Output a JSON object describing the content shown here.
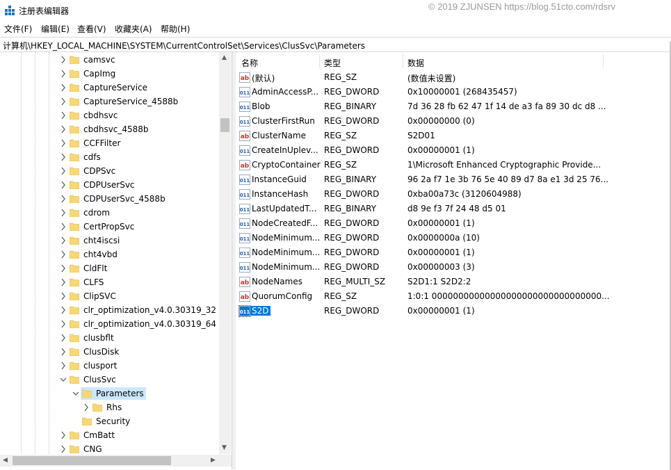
{
  "window": {
    "title": "注册表编辑器",
    "watermark": "© 2019 ZJUNSEN https://blog.51cto.com/rdsrv"
  },
  "menu": [
    "文件(F)",
    "编辑(E)",
    "查看(V)",
    "收藏夹(A)",
    "帮助(H)"
  ],
  "address": "计算机\\HKEY_LOCAL_MACHINE\\SYSTEM\\CurrentControlSet\\Services\\ClusSvc\\Parameters",
  "tree": {
    "items": [
      {
        "label": "camsvc",
        "level": 1,
        "expander": "collapsed"
      },
      {
        "label": "CapImg",
        "level": 1,
        "expander": "collapsed"
      },
      {
        "label": "CaptureService",
        "level": 1,
        "expander": "collapsed"
      },
      {
        "label": "CaptureService_4588b",
        "level": 1,
        "expander": "collapsed"
      },
      {
        "label": "cbdhsvc",
        "level": 1,
        "expander": "collapsed"
      },
      {
        "label": "cbdhsvc_4588b",
        "level": 1,
        "expander": "collapsed"
      },
      {
        "label": "CCFFilter",
        "level": 1,
        "expander": "collapsed"
      },
      {
        "label": "cdfs",
        "level": 1,
        "expander": "collapsed"
      },
      {
        "label": "CDPSvc",
        "level": 1,
        "expander": "collapsed"
      },
      {
        "label": "CDPUserSvc",
        "level": 1,
        "expander": "collapsed"
      },
      {
        "label": "CDPUserSvc_4588b",
        "level": 1,
        "expander": "collapsed"
      },
      {
        "label": "cdrom",
        "level": 1,
        "expander": "collapsed"
      },
      {
        "label": "CertPropSvc",
        "level": 1,
        "expander": "collapsed"
      },
      {
        "label": "cht4iscsi",
        "level": 1,
        "expander": "collapsed"
      },
      {
        "label": "cht4vbd",
        "level": 1,
        "expander": "collapsed"
      },
      {
        "label": "CldFlt",
        "level": 1,
        "expander": "collapsed"
      },
      {
        "label": "CLFS",
        "level": 1,
        "expander": "collapsed"
      },
      {
        "label": "ClipSVC",
        "level": 1,
        "expander": "collapsed"
      },
      {
        "label": "clr_optimization_v4.0.30319_32",
        "level": 1,
        "expander": "collapsed"
      },
      {
        "label": "clr_optimization_v4.0.30319_64",
        "level": 1,
        "expander": "collapsed"
      },
      {
        "label": "clusbflt",
        "level": 1,
        "expander": "collapsed"
      },
      {
        "label": "ClusDisk",
        "level": 1,
        "expander": "collapsed"
      },
      {
        "label": "clusport",
        "level": 1,
        "expander": "collapsed"
      },
      {
        "label": "ClusSvc",
        "level": 1,
        "expander": "expanded"
      },
      {
        "label": "Parameters",
        "level": 2,
        "expander": "expanded",
        "selected": true
      },
      {
        "label": "Rhs",
        "level": 3,
        "expander": "collapsed"
      },
      {
        "label": "Security",
        "level": 2,
        "expander": "none"
      },
      {
        "label": "CmBatt",
        "level": 1,
        "expander": "collapsed"
      },
      {
        "label": "CNG",
        "level": 1,
        "expander": "collapsed"
      }
    ]
  },
  "list": {
    "headers": {
      "name": "名称",
      "type": "类型",
      "data": "数据"
    },
    "rows": [
      {
        "icon": "string-value-icon",
        "name": "(默认)",
        "type": "REG_SZ",
        "data": "(数值未设置)"
      },
      {
        "icon": "binary-value-icon",
        "name": "AdminAccessP...",
        "type": "REG_DWORD",
        "data": "0x10000001 (268435457)"
      },
      {
        "icon": "binary-value-icon",
        "name": "Blob",
        "type": "REG_BINARY",
        "data": "7d 36 28 fb 62 47 1f 14 de a3 fa 89 30 dc d8 ..."
      },
      {
        "icon": "binary-value-icon",
        "name": "ClusterFirstRun",
        "type": "REG_DWORD",
        "data": "0x00000000 (0)"
      },
      {
        "icon": "string-value-icon",
        "name": "ClusterName",
        "type": "REG_SZ",
        "data": "S2D01"
      },
      {
        "icon": "binary-value-icon",
        "name": "CreateInUplev...",
        "type": "REG_DWORD",
        "data": "0x00000001 (1)"
      },
      {
        "icon": "string-value-icon",
        "name": "CryptoContainer",
        "type": "REG_SZ",
        "data": "1\\Microsoft Enhanced Cryptographic Provide..."
      },
      {
        "icon": "binary-value-icon",
        "name": "InstanceGuid",
        "type": "REG_BINARY",
        "data": "96 2a f7 1e 3b 76 5e 40 89 d7 8a e1 3d 25 76..."
      },
      {
        "icon": "binary-value-icon",
        "name": "InstanceHash",
        "type": "REG_DWORD",
        "data": "0xba00a73c (3120604988)"
      },
      {
        "icon": "binary-value-icon",
        "name": "LastUpdatedT...",
        "type": "REG_BINARY",
        "data": "d8 9e f3 7f 24 48 d5 01"
      },
      {
        "icon": "binary-value-icon",
        "name": "NodeCreatedF...",
        "type": "REG_DWORD",
        "data": "0x00000001 (1)"
      },
      {
        "icon": "binary-value-icon",
        "name": "NodeMinimum...",
        "type": "REG_DWORD",
        "data": "0x0000000a (10)"
      },
      {
        "icon": "binary-value-icon",
        "name": "NodeMinimum...",
        "type": "REG_DWORD",
        "data": "0x00000001 (1)"
      },
      {
        "icon": "binary-value-icon",
        "name": "NodeMinimum...",
        "type": "REG_DWORD",
        "data": "0x00000003 (3)"
      },
      {
        "icon": "string-value-icon",
        "name": "NodeNames",
        "type": "REG_MULTI_SZ",
        "data": "S2D1:1 S2D2:2"
      },
      {
        "icon": "string-value-icon",
        "name": "QuorumConfig",
        "type": "REG_SZ",
        "data": "1:0:1 00000000000000000000000000000000..."
      },
      {
        "icon": "binary-value-icon",
        "name": "S2D",
        "type": "REG_DWORD",
        "data": "0x00000001 (1)",
        "selected": true
      }
    ]
  },
  "colors": {
    "selection": "#0078d7",
    "tree_selection": "#cce8ff",
    "folder": "#f8d775",
    "string_icon": "#c0392b",
    "binary_icon": "#2b5fb5"
  }
}
